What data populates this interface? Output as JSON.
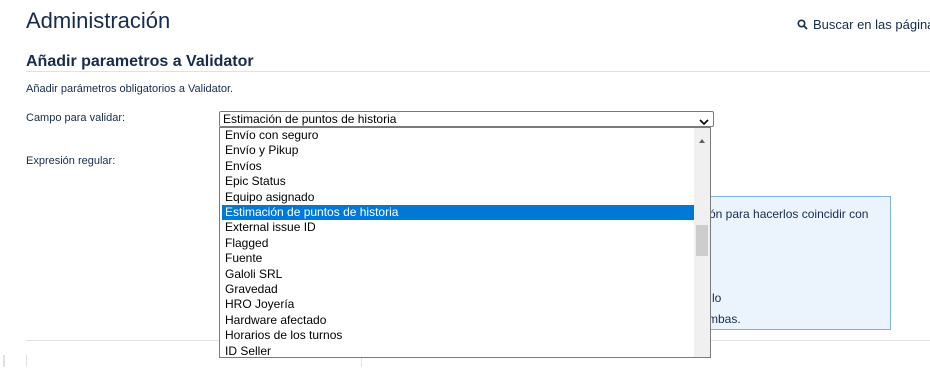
{
  "header": {
    "title": "Administración",
    "search_label": "Buscar en las páginas",
    "search_icon": "search-icon"
  },
  "section": {
    "title": "Añadir parametros a Validator",
    "description": "Añadir parámetros obligatorios a Validator."
  },
  "form": {
    "field_label": "Campo para validar:",
    "field_selected": "Estimación de puntos de historia",
    "regex_label": "Expresión regular:"
  },
  "dropdown": {
    "options": [
      "Envío con seguro",
      "Envío y Pikup",
      "Envíos",
      "Epic Status",
      "Equipo asignado",
      "Estimación de puntos de historia",
      "External issue ID",
      "Flagged",
      "Fuente",
      "Galoli SRL",
      "Gravedad",
      "HRO Joyería",
      "Hardware afectado",
      "Horarios de los turnos",
      "ID Seller"
    ],
    "selected_index": 5,
    "selected_color": "#0078d7"
  },
  "help_panel": {
    "line1": "ón para hacerlos coincidir con",
    "line2": "lo",
    "line3": "mbas."
  }
}
